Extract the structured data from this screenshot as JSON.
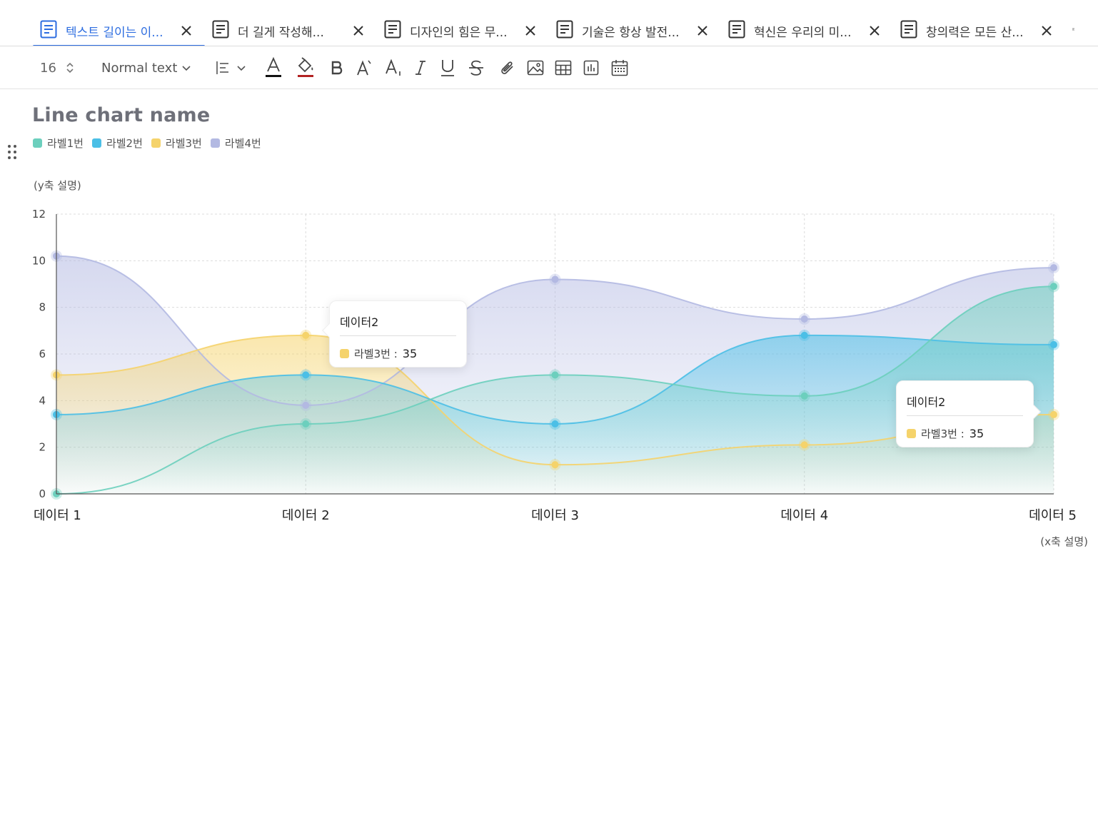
{
  "tabs": [
    {
      "label": "텍스트 길이는 이...",
      "active": true
    },
    {
      "label": "더 길게 작성해...",
      "active": false
    },
    {
      "label": "디자인의 힘은 무...",
      "active": false
    },
    {
      "label": "기술은 항상 발전...",
      "active": false
    },
    {
      "label": "혁신은 우리의 미...",
      "active": false
    },
    {
      "label": "창의력은 모든 산...",
      "active": false
    },
    {
      "label": "",
      "active": false
    }
  ],
  "toolbar": {
    "font_size": "16",
    "text_style": "Normal text",
    "tools": [
      "font-size-stepper",
      "text-style-select",
      "align-select",
      "text-color",
      "highlight-color",
      "bold",
      "superscript",
      "subscript",
      "italic",
      "underline",
      "strikethrough",
      "attach",
      "insert-image",
      "insert-table",
      "insert-chart",
      "insert-calendar"
    ]
  },
  "colors": {
    "accent": "#2d6de0",
    "series1": "#6ccfbd",
    "series2": "#4bbfe6",
    "series3": "#f5d36b",
    "series4": "#b3b9e2"
  },
  "chart_data": {
    "type": "area",
    "title": "Line chart name",
    "ylabel": "(y축 설명)",
    "xlabel": "(x축 설명)",
    "categories": [
      "데이터 1",
      "데이터 2",
      "데이터 3",
      "데이터 4",
      "데이터 5"
    ],
    "ylim": [
      0,
      12
    ],
    "yticks": [
      0,
      2,
      4,
      6,
      8,
      10,
      12
    ],
    "grid": true,
    "legend_position": "top-left",
    "series": [
      {
        "name": "라벨1번",
        "color": "#6ccfbd",
        "values": [
          0,
          3,
          5.1,
          4.2,
          8.9
        ]
      },
      {
        "name": "라벨2번",
        "color": "#4bbfe6",
        "values": [
          3.4,
          5.1,
          3,
          6.8,
          6.4
        ]
      },
      {
        "name": "라벨3번",
        "color": "#f5d36b",
        "values": [
          5.1,
          6.8,
          1.25,
          2.1,
          3.4
        ]
      },
      {
        "name": "라벨4번",
        "color": "#b3b9e2",
        "values": [
          10.2,
          3.8,
          9.2,
          7.5,
          9.7
        ]
      }
    ]
  },
  "tooltips": [
    {
      "title": "데이터2",
      "label": "라벨3번 :",
      "value": "35",
      "color": "#f5d36b"
    },
    {
      "title": "데이터2",
      "label": "라벨3번 :",
      "value": "35",
      "color": "#f5d36b"
    }
  ]
}
